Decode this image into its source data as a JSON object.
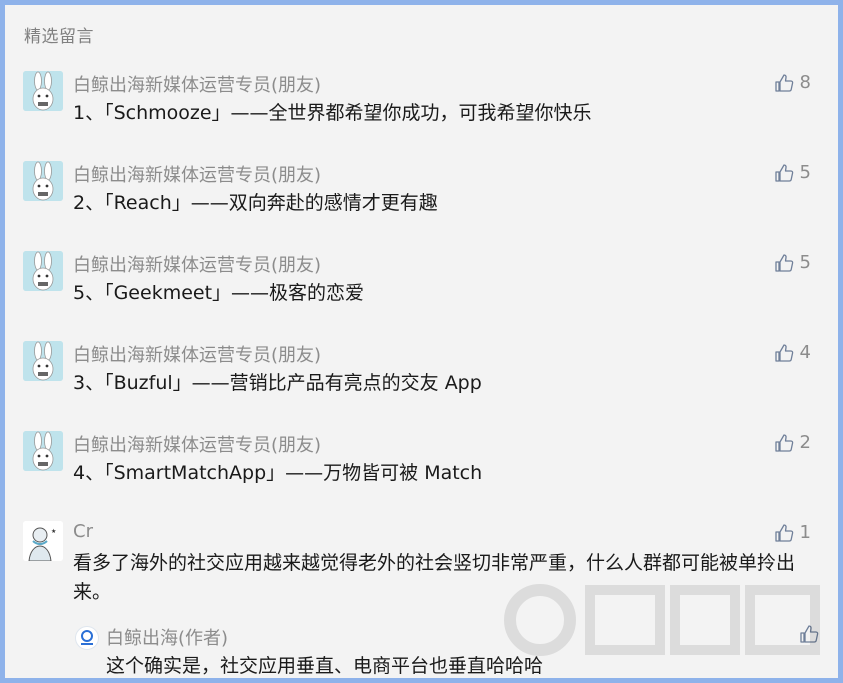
{
  "section": {
    "title": "精选留言"
  },
  "comments": [
    {
      "nickname": "白鲸出海新媒体运营专员(朋友)",
      "content": "1、「Schmooze」——全世界都希望你成功，可我希望你快乐",
      "likes": "8"
    },
    {
      "nickname": "白鲸出海新媒体运营专员(朋友)",
      "content": "2、「Reach」——双向奔赴的感情才更有趣",
      "likes": "5"
    },
    {
      "nickname": "白鲸出海新媒体运营专员(朋友)",
      "content": "5、「Geekmeet」——极客的恋爱",
      "likes": "5"
    },
    {
      "nickname": "白鲸出海新媒体运营专员(朋友)",
      "content": "3、「Buzful」——营销比产品有亮点的交友 App",
      "likes": "4"
    },
    {
      "nickname": "白鲸出海新媒体运营专员(朋友)",
      "content": "4、「SmartMatchApp」——万物皆可被 Match",
      "likes": "2"
    },
    {
      "nickname": "Cr",
      "content": "看多了海外的社交应用越来越觉得老外的社会竖切非常严重，什么人群都可能被单拎出来。",
      "likes": "1"
    }
  ],
  "reply": {
    "nickname": "白鲸出海(作者)",
    "content": "这个确实是，社交应用垂直、电商平台也垂直哈哈哈"
  },
  "icons": {
    "like": "thumbs-up-icon",
    "avatar": "rabbit-avatar-icon",
    "author_avatar": "baijing-logo-icon"
  },
  "colors": {
    "frame_border": "#8eb2ea",
    "background": "#f3f3f3",
    "meta_text": "#8c8c8c",
    "body_text": "#1a1a1a"
  }
}
